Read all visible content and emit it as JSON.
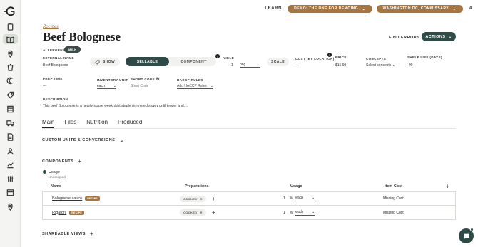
{
  "topbar": {
    "learn": "LEARN",
    "org": "DEMO: THE ONE FOR DEMOING",
    "location": "WASHINGTON DC, COMMISSARY",
    "avatar_initial": "A"
  },
  "header": {
    "breadcrumb": "Recipes",
    "title": "Beef Bolognese",
    "find_errors": "FIND ERRORS",
    "actions": "ACTIONS"
  },
  "fields": {
    "allergens_label": "ALLERGENS:",
    "allergen": "MILK",
    "external_name_label": "EXTERNAL NAME",
    "external_name": "Beef Bolognese",
    "show": "SHOW",
    "sellable": "SELLABLE",
    "component": "COMPONENT",
    "yield_label": "YIELD",
    "yield_qty": "1",
    "yield_unit": "bag",
    "scale": "SCALE",
    "cost_label": "COST (BY LOCATION)",
    "cost": "---",
    "price_label": "PRICE",
    "price": "$15.99",
    "concepts_label": "CONCEPTS",
    "concepts": "Select concepts",
    "shelf_life_label": "SHELF LIFE (DAYS)",
    "shelf_life": "90",
    "prep_time_label": "PREP TIME",
    "prep_time": "---",
    "inventory_unit_label": "INVENTORY UNIT",
    "inventory_unit": "each",
    "short_code_label": "SHORT CODE",
    "short_code_placeholder": "Short Code",
    "haccp_label": "HACCP RULES",
    "haccp_placeholder": "Add HACCP Rules",
    "description_label": "DESCRIPTION",
    "description": "This beef Bolognese is a hearty staple weeknight staple simmered slowly until tender and...."
  },
  "tabs": [
    "Main",
    "Files",
    "Nutrition",
    "Produced"
  ],
  "sections": {
    "custom_units": "CUSTOM UNITS & CONVERSIONS",
    "components": "COMPONENTS",
    "shareable_views": "SHAREABLE VIEWS"
  },
  "usage": {
    "name": "Usage",
    "sub": "Unassigned"
  },
  "table": {
    "headers": [
      "Name",
      "Preparations",
      "Usage",
      "Item Cost"
    ],
    "rows": [
      {
        "name": "Bolognese sauce",
        "badge": "RECIPE",
        "prep": "COOKED",
        "qty": "1",
        "unit": "each",
        "cost": "Missing Cost"
      },
      {
        "name": "Rigatoni",
        "badge": "RECIPE",
        "prep": "COOKED",
        "qty": "1",
        "unit": "each",
        "cost": "Missing Cost"
      }
    ]
  },
  "colors": {
    "accent": "#a57642",
    "primary": "#2f4b48"
  }
}
